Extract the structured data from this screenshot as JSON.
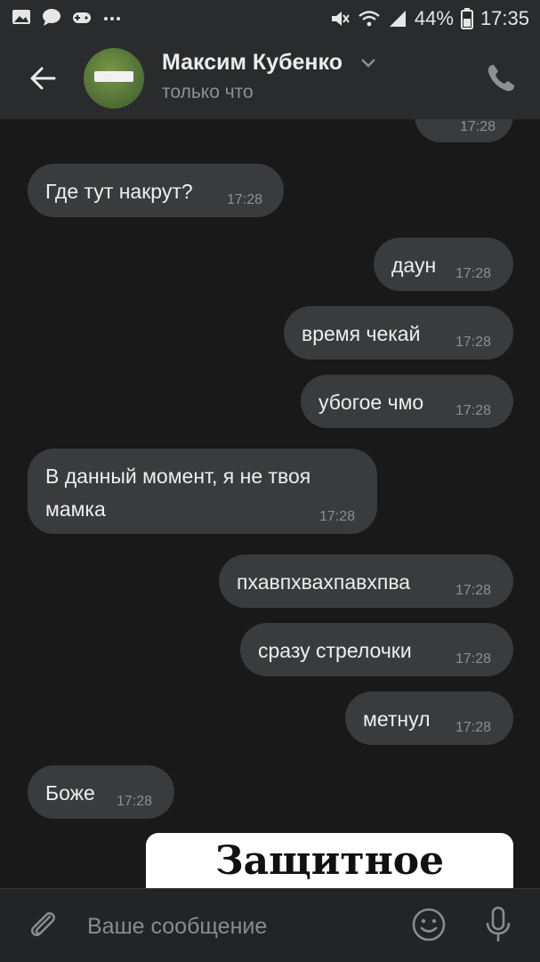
{
  "statusbar": {
    "battery": "44%",
    "time": "17:35",
    "icons": [
      "gallery-icon",
      "chat-icon",
      "game-icon",
      "more-icon",
      "mute-icon",
      "wifi-icon",
      "signal-icon",
      "battery-icon"
    ]
  },
  "header": {
    "name": "Максим Кубенко",
    "status": "только что",
    "icons": [
      "back-arrow-icon",
      "chevron-down-icon",
      "phone-icon"
    ]
  },
  "messages": [
    {
      "side": "out",
      "text": "",
      "time": "17:28"
    },
    {
      "side": "in",
      "text": "Где тут накрут?",
      "time": "17:28"
    },
    {
      "side": "out",
      "text": "даун",
      "time": "17:28"
    },
    {
      "side": "out",
      "text": "время чекай",
      "time": "17:28"
    },
    {
      "side": "out",
      "text": "убогое чмо",
      "time": "17:28"
    },
    {
      "side": "in",
      "text": "В данный момент, я не твоя",
      "text2": "мамка",
      "time": "17:28"
    },
    {
      "side": "out",
      "text": "пхавпхвахпавхпва",
      "time": "17:28"
    },
    {
      "side": "out",
      "text": "сразу стрелочки",
      "time": "17:28"
    },
    {
      "side": "out",
      "text": "метнул",
      "time": "17:28"
    },
    {
      "side": "in",
      "text": "Боже",
      "time": "17:28"
    }
  ],
  "sticker": {
    "text": "Защитное"
  },
  "input": {
    "placeholder": "Ваше сообщение",
    "icons": [
      "attach-icon",
      "emoji-icon",
      "microphone-icon"
    ]
  },
  "colors": {
    "background": "#19191a",
    "bar": "#2a2b2c",
    "bubble": "#3a3b3d",
    "muted_text": "#8d8e90"
  }
}
